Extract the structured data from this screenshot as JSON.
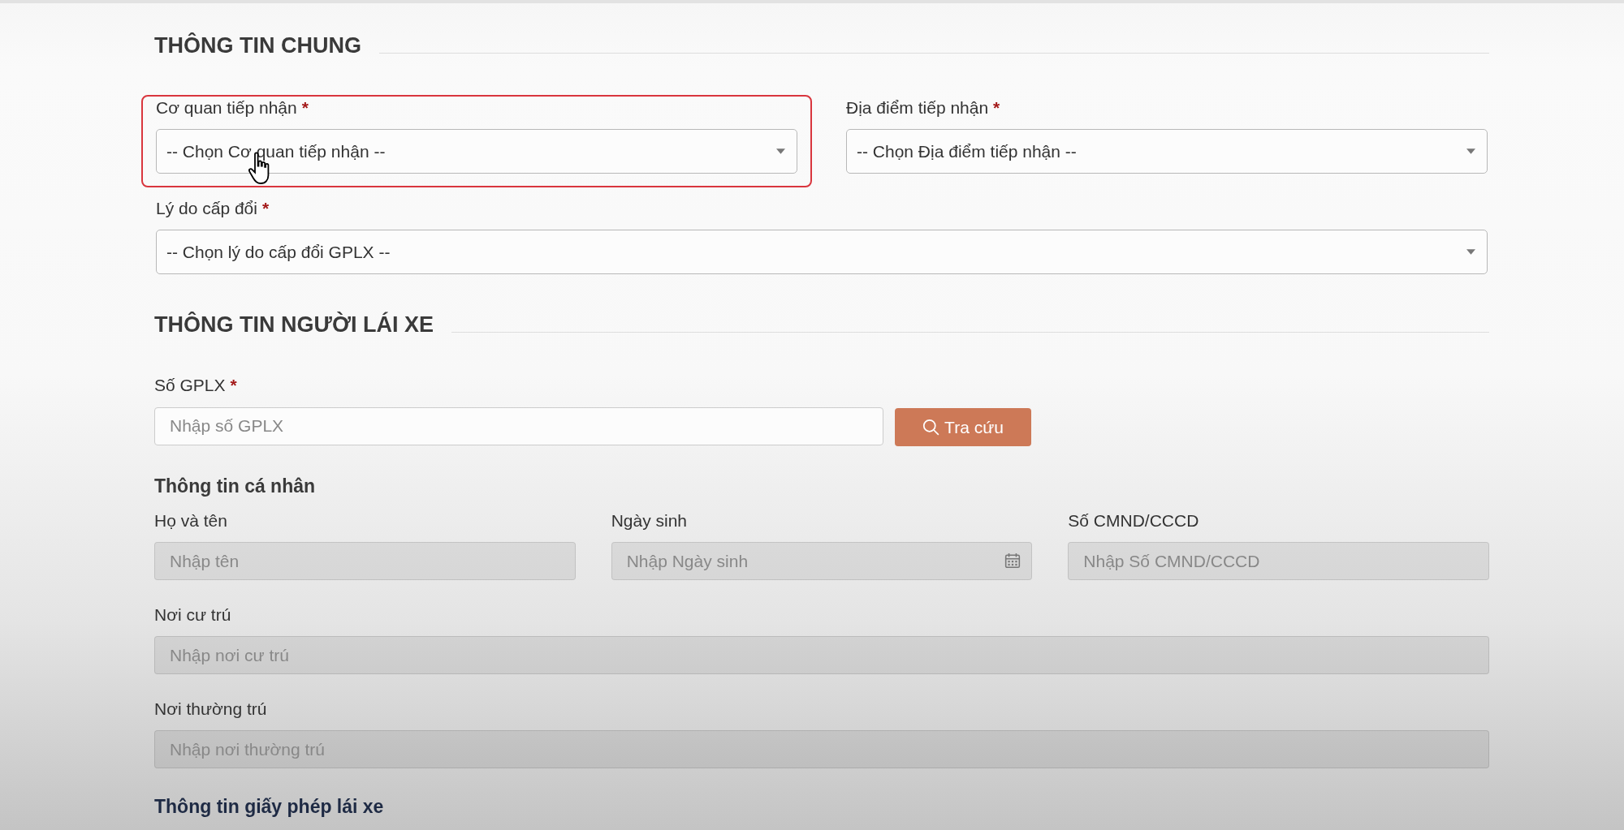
{
  "general": {
    "title": "THÔNG TIN CHUNG",
    "rows": [
      [
        {
          "kind": "select",
          "label": "Cơ quan tiếp nhận",
          "required_mark": "*",
          "placeholder": "-- Chọn Cơ quan tiếp nhận --",
          "highlighted": true,
          "pointer": true
        },
        {
          "kind": "select",
          "label": "Địa điểm tiếp nhận",
          "required_mark": "*",
          "placeholder": "-- Chọn Địa điểm tiếp nhận --"
        }
      ],
      [
        {
          "kind": "select",
          "label": "Lý do cấp đổi",
          "required_mark": "*",
          "placeholder": "-- Chọn lý do cấp đổi GPLX --"
        }
      ]
    ]
  },
  "driver": {
    "title": "THÔNG TIN NGƯỜI LÁI XE",
    "license": {
      "label": "Số GPLX",
      "required_mark": "*",
      "placeholder": "Nhập số GPLX",
      "button": "Tra cứu"
    },
    "personal": {
      "title": "Thông tin cá nhân",
      "rows": [
        [
          {
            "kind": "input",
            "label": "Họ và tên",
            "placeholder": "Nhập tên",
            "disabled": true
          },
          {
            "kind": "date",
            "label": "Ngày sinh",
            "placeholder": "Nhập Ngày sinh",
            "disabled": true
          },
          {
            "kind": "input",
            "label": "Số CMND/CCCD",
            "placeholder": "Nhập Số CMND/CCCD",
            "disabled": true
          }
        ],
        [
          {
            "kind": "input",
            "label": "Nơi cư trú",
            "placeholder": "Nhập nơi cư trú",
            "disabled": true
          }
        ],
        [
          {
            "kind": "input",
            "label": "Nơi thường trú",
            "placeholder": "Nhập nơi thường trú",
            "disabled": true
          }
        ]
      ]
    },
    "license_info": {
      "title": "Thông tin giấy phép lái xe"
    }
  }
}
